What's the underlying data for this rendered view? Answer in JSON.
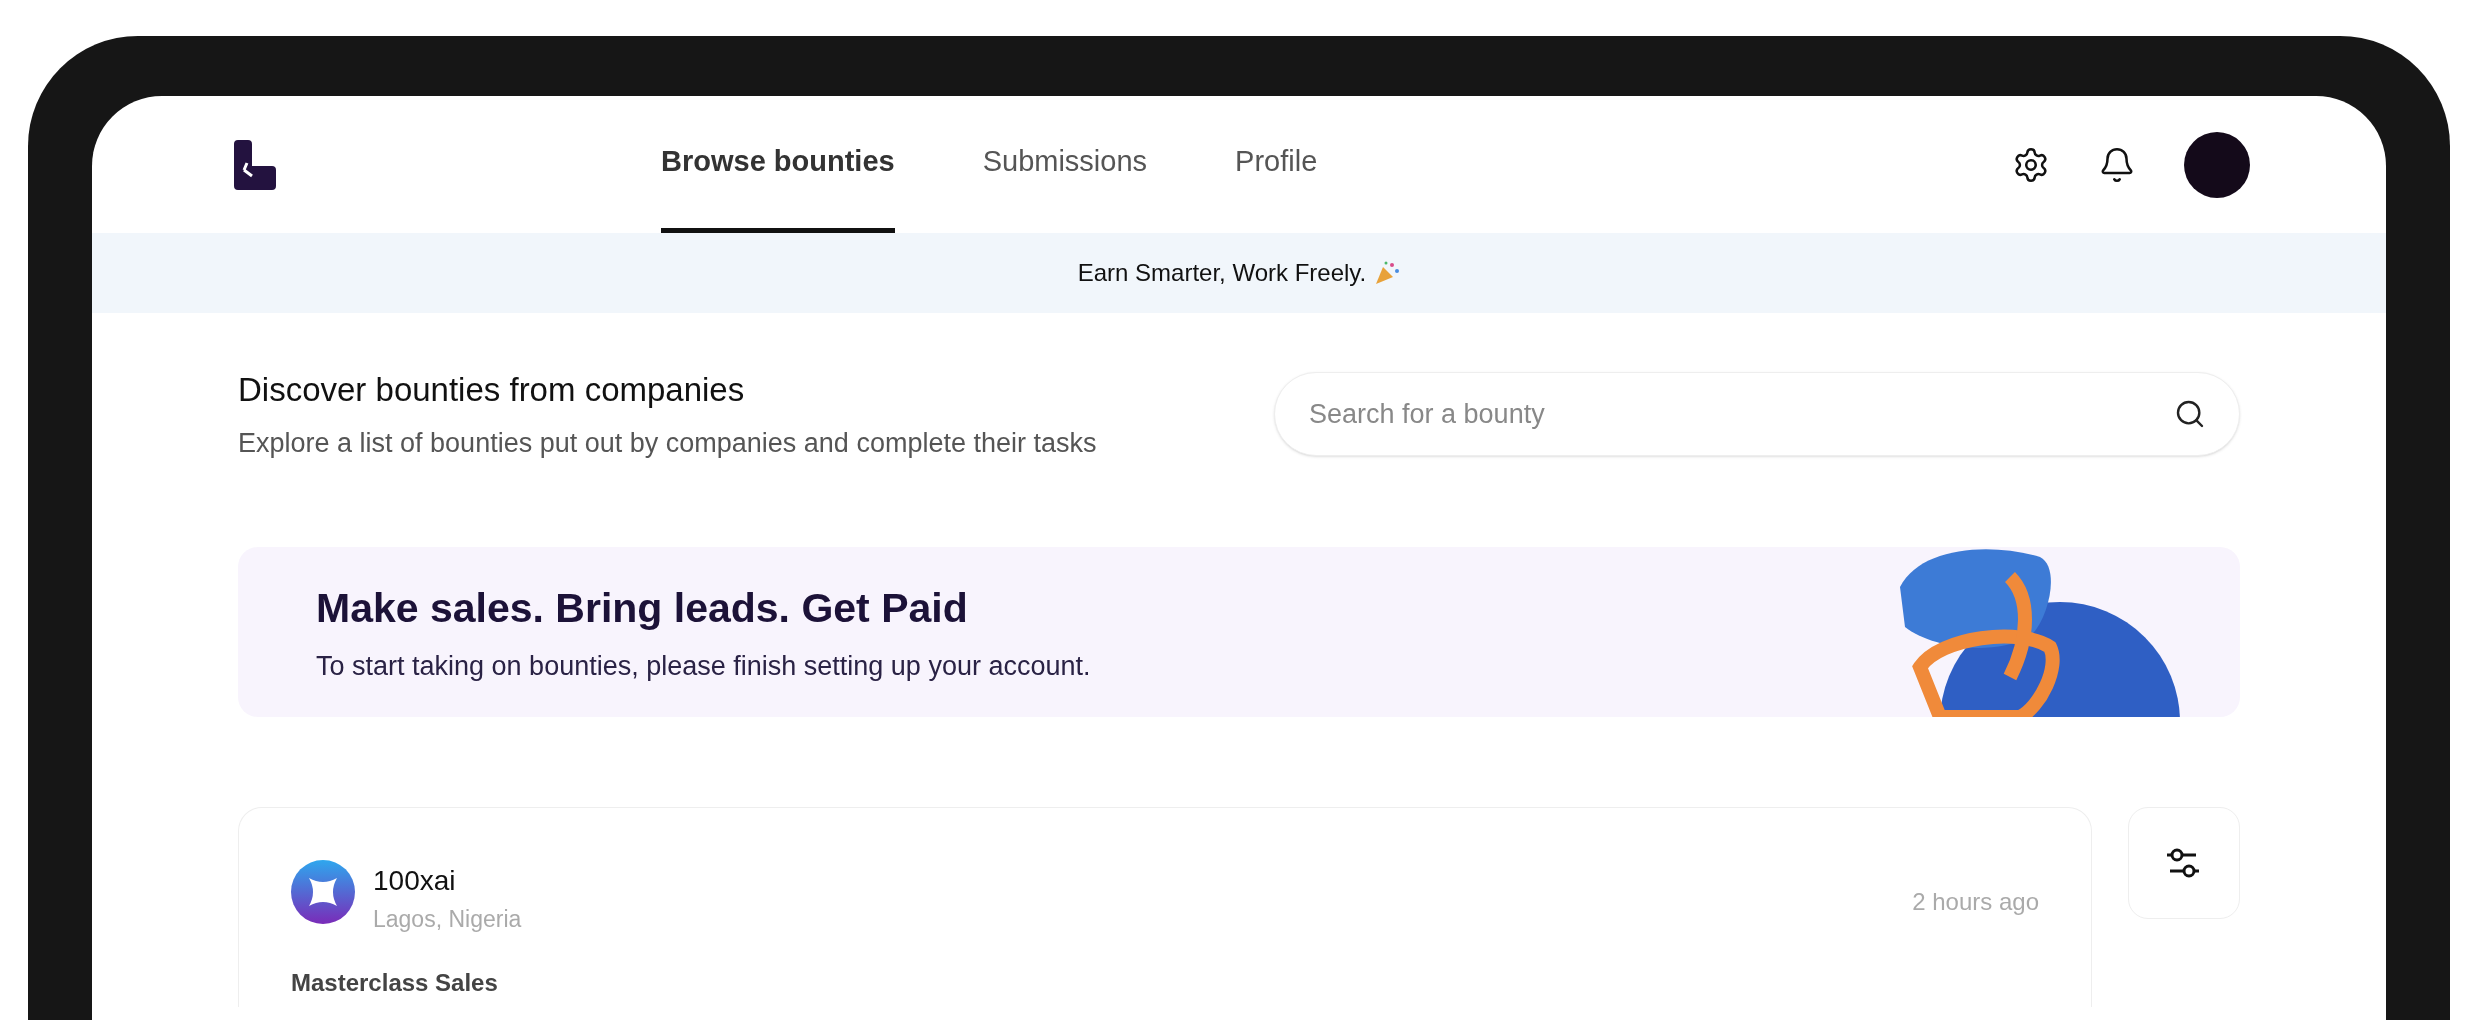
{
  "nav": {
    "tabs": [
      {
        "label": "Browse bounties",
        "selected": true
      },
      {
        "label": "Submissions",
        "selected": false
      },
      {
        "label": "Profile",
        "selected": false
      }
    ]
  },
  "announcement": {
    "text": "Earn Smarter, Work Freely."
  },
  "header": {
    "title": "Discover bounties from companies",
    "subtitle": "Explore a list of bounties put out by companies and complete their tasks"
  },
  "search": {
    "placeholder": "Search for a bounty"
  },
  "promo": {
    "title": "Make sales. Bring leads. Get Paid",
    "text": "To start taking on bounties, please finish setting up your account."
  },
  "bounties": [
    {
      "company": "100xai",
      "location": "Lagos, Nigeria",
      "time": "2 hours ago",
      "title": "Masterclass Sales"
    }
  ]
}
